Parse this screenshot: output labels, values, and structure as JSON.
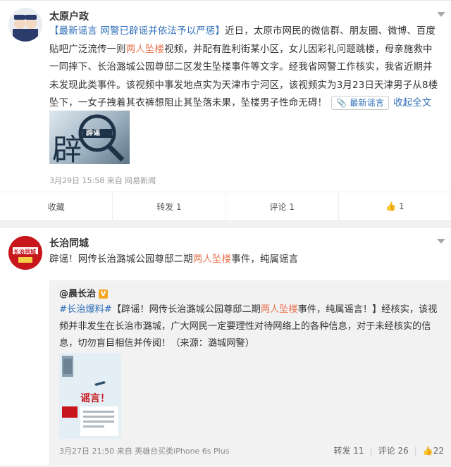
{
  "post1": {
    "author": "太原户政",
    "text_before_link": "",
    "headline": "【最新谣言 网警已辟谣并依法予以严惩】",
    "body_a": "近日，太原市网民的微信群、朋友圈、微博、百度贴吧广泛流传一则",
    "highlight": "两人坠楼",
    "body_b": "视频，并配有胜利街某小区，女儿因彩礼问题跳楼，母亲施救中一同摔下、长治潞城公园尊邸二区发生坠楼事件等文字。经我省网警工作核实，我省近期并未发现此类事件。该视频中事发地点实为天津市宁河区，该视频实为3月23日天津男子从8楼坠下，一女子拽着其衣裤想阻止其坠落未果，坠楼男子性命无碍！",
    "tag_button": "最新谣言",
    "collapse_link": "收起全文",
    "image_caption": "辟谣",
    "meta": "3月29日 15:58 来自 网易新闻",
    "actions": {
      "favorite": "收藏",
      "repost": "转发 1",
      "comment": "评论 1",
      "like": "1"
    }
  },
  "post2": {
    "author": "长治同城",
    "avatar_text": "长治同城",
    "text_a": "辟谣！网传长治潞城公园尊邸二期",
    "highlight": "两人坠楼",
    "text_b": "事件，纯属谣言",
    "repost": {
      "author": "@晨长治",
      "badge": "V",
      "hashtag": "#长治爆料#",
      "text_a": "【辟谣！网传长治潞城公园尊邸二期",
      "highlight": "两人坠楼",
      "text_b": "事件，纯属谣言！】经核实，该视频并非发生在长治市潞城，广大网民一定要理性对待网络上的各种信息，对于未经核实的信息，切勿盲目相信并传阅！（来源：潞城网警）",
      "image_caption": "谣言！",
      "meta": "3月27日 21:50 来自 英雄台买类iPhone 6s Plus",
      "stats": {
        "repost": "转发 11",
        "comment": "评论 26",
        "like": "22"
      }
    }
  }
}
